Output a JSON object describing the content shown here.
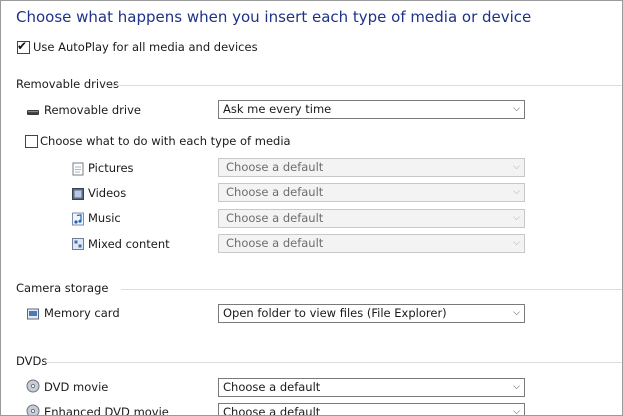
{
  "title": "Choose what happens when you insert each type of media or device",
  "autoplay": {
    "label": "Use AutoPlay for all media and devices",
    "checked": true
  },
  "sections": {
    "removable": {
      "heading": "Removable drives",
      "drive_label": "Removable drive",
      "drive_value": "Ask me every time",
      "per_media": {
        "label": "Choose what to do with each type of media",
        "checked": false
      },
      "media": [
        {
          "label": "Pictures",
          "value": "Choose a default",
          "icon": "picture-file-icon"
        },
        {
          "label": "Videos",
          "value": "Choose a default",
          "icon": "video-file-icon"
        },
        {
          "label": "Music",
          "value": "Choose a default",
          "icon": "music-file-icon"
        },
        {
          "label": "Mixed content",
          "value": "Choose a default",
          "icon": "mixed-content-icon"
        }
      ]
    },
    "camera": {
      "heading": "Camera storage",
      "card_label": "Memory card",
      "card_value": "Open folder to view files (File Explorer)"
    },
    "dvds": {
      "heading": "DVDs",
      "items": [
        {
          "label": "DVD movie",
          "value": "Choose a default",
          "icon": "dvd-disc-icon"
        },
        {
          "label": "Enhanced DVD movie",
          "value": "Choose a default",
          "icon": "dvd-disc-icon"
        }
      ]
    }
  },
  "arrow_glyph": "⌵",
  "check_glyph": "✔",
  "colors": {
    "title": "#1e3287",
    "rule": "#dcdcdc"
  }
}
